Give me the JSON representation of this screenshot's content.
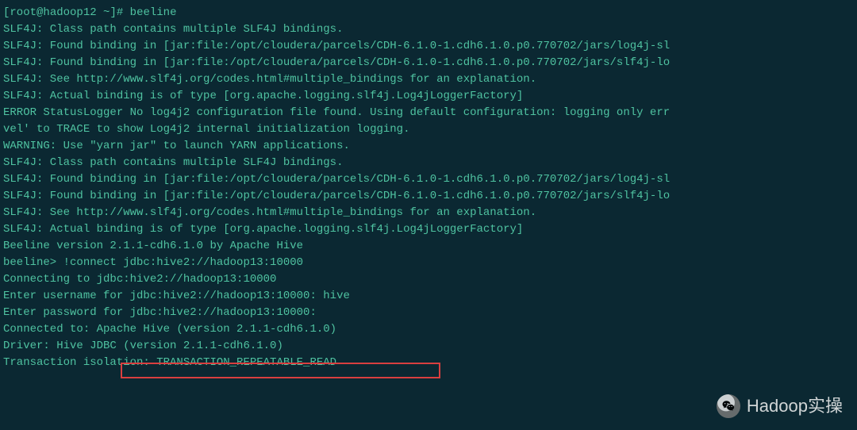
{
  "prompt": {
    "user": "root",
    "host": "hadoop12",
    "cwd": "~",
    "command": "beeline"
  },
  "lines": [
    "SLF4J: Class path contains multiple SLF4J bindings.",
    "SLF4J: Found binding in [jar:file:/opt/cloudera/parcels/CDH-6.1.0-1.cdh6.1.0.p0.770702/jars/log4j-sl",
    "SLF4J: Found binding in [jar:file:/opt/cloudera/parcels/CDH-6.1.0-1.cdh6.1.0.p0.770702/jars/slf4j-lo",
    "SLF4J: See http://www.slf4j.org/codes.html#multiple_bindings for an explanation.",
    "SLF4J: Actual binding is of type [org.apache.logging.slf4j.Log4jLoggerFactory]",
    "ERROR StatusLogger No log4j2 configuration file found. Using default configuration: logging only err",
    "vel' to TRACE to show Log4j2 internal initialization logging.",
    "WARNING: Use \"yarn jar\" to launch YARN applications.",
    "SLF4J: Class path contains multiple SLF4J bindings.",
    "SLF4J: Found binding in [jar:file:/opt/cloudera/parcels/CDH-6.1.0-1.cdh6.1.0.p0.770702/jars/log4j-sl",
    "SLF4J: Found binding in [jar:file:/opt/cloudera/parcels/CDH-6.1.0-1.cdh6.1.0.p0.770702/jars/slf4j-lo",
    "SLF4J: See http://www.slf4j.org/codes.html#multiple_bindings for an explanation.",
    "SLF4J: Actual binding is of type [org.apache.logging.slf4j.Log4jLoggerFactory]",
    "Beeline version 2.1.1-cdh6.1.0 by Apache Hive",
    "beeline> !connect jdbc:hive2://hadoop13:10000",
    "Connecting to jdbc:hive2://hadoop13:10000",
    "Enter username for jdbc:hive2://hadoop13:10000: hive",
    "Enter password for jdbc:hive2://hadoop13:10000:",
    "Connected to: Apache Hive (version 2.1.1-cdh6.1.0)",
    "Driver: Hive JDBC (version 2.1.1-cdh6.1.0)",
    "Transaction isolation: TRANSACTION_REPEATABLE_READ"
  ],
  "highlight": {
    "text": "Apache Hive (version 2.1.1-cdh6.1.0)"
  },
  "watermark": {
    "text": "Hadoop实操"
  }
}
